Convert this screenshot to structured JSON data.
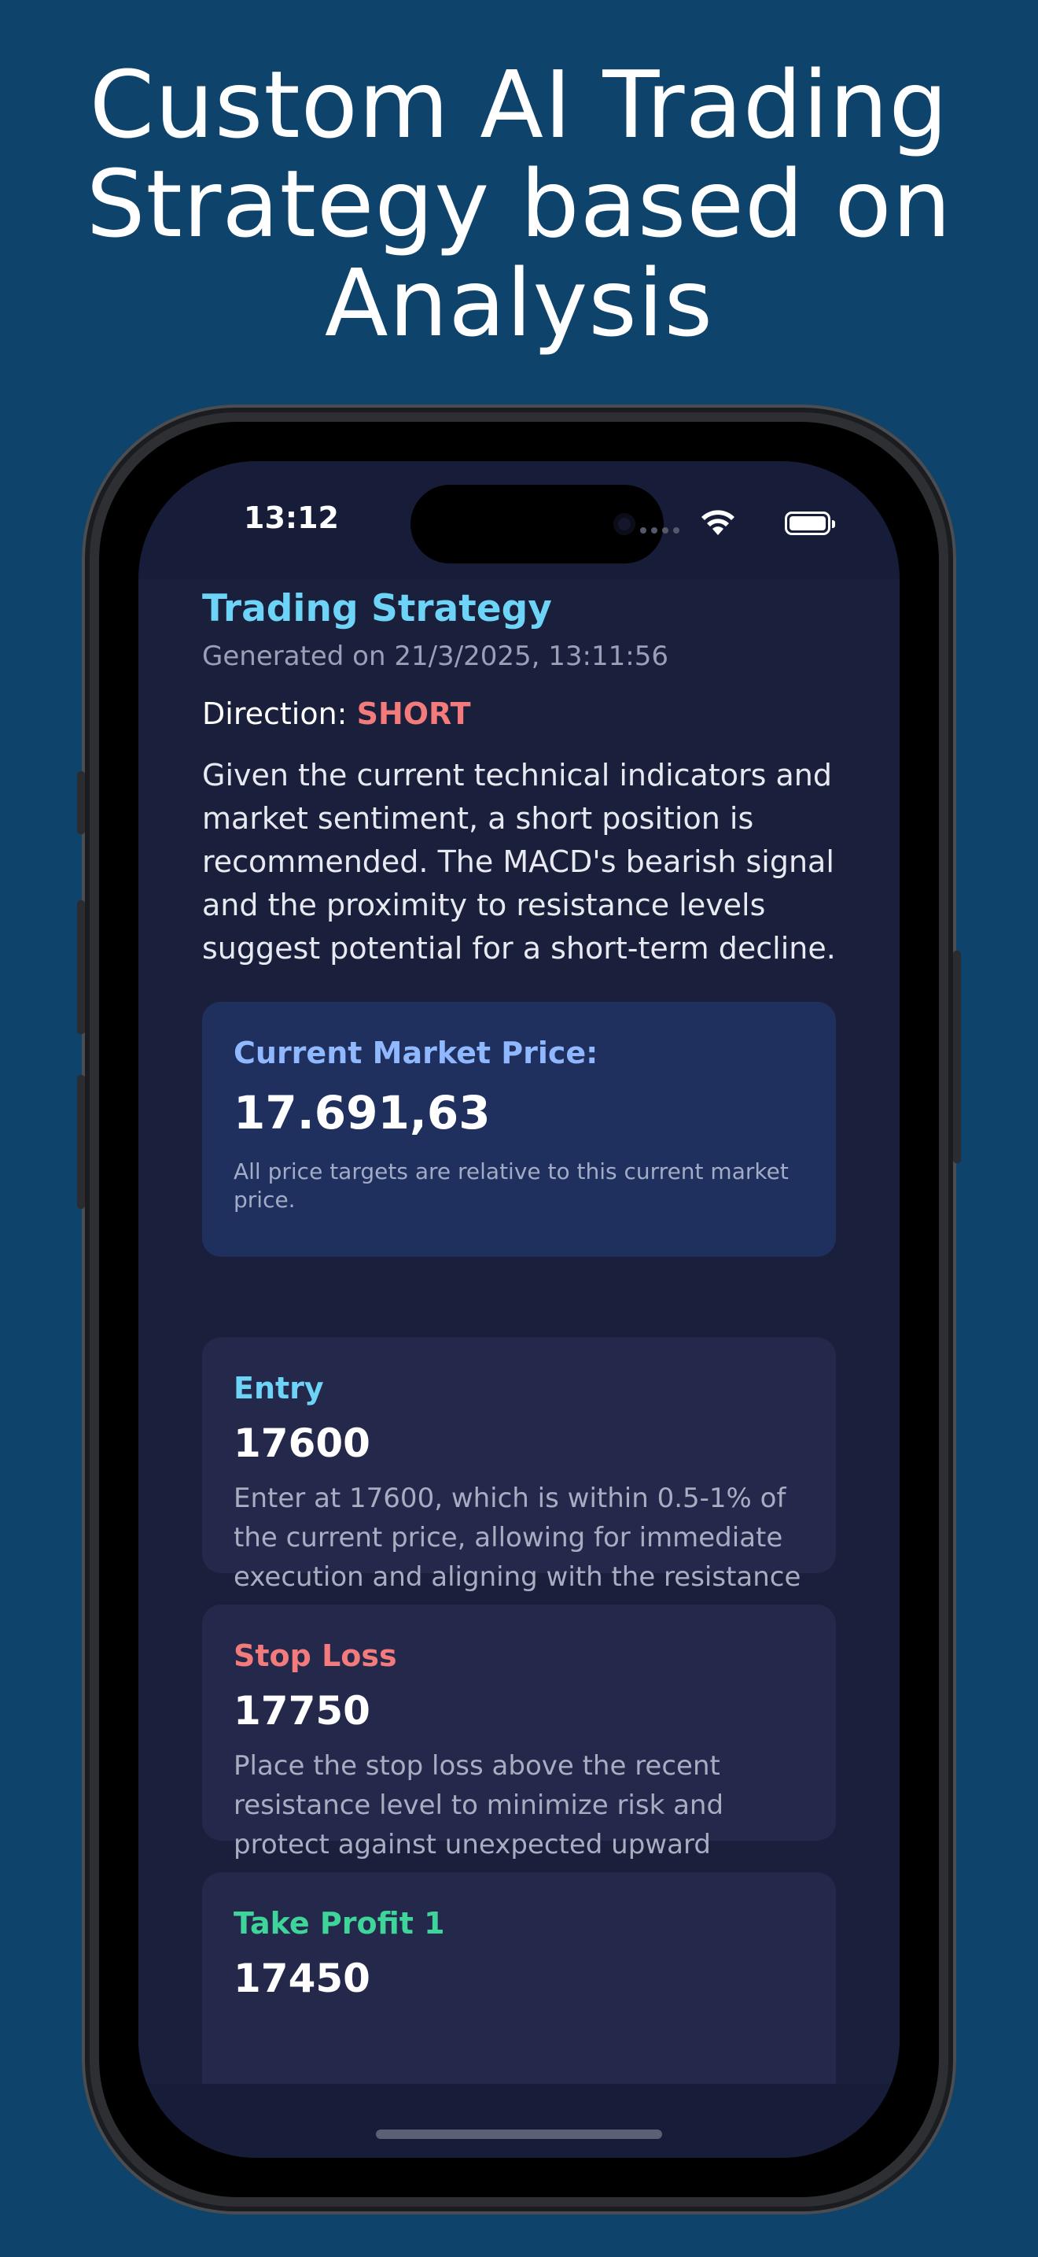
{
  "headline": {
    "line1": "Custom AI Trading",
    "line2": "Strategy based on",
    "line3": "Analysis"
  },
  "status_bar": {
    "time": "13:12",
    "icons": [
      "signal-icon",
      "wifi-icon",
      "battery-icon"
    ]
  },
  "strategy": {
    "title": "Trading Strategy",
    "generated": "Generated on 21/3/2025, 13:11:56",
    "direction_label": "Direction:",
    "direction_value": "SHORT",
    "summary": "Given the current technical indicators and market sentiment, a short position is recommended. The MACD's bearish signal and the proximity to resistance levels suggest potential for a short-term decline."
  },
  "market_price": {
    "label": "Current Market Price:",
    "value": "17.691,63",
    "note": "All price targets are relative to this current market price."
  },
  "levels": [
    {
      "label": "Entry",
      "value": "17600",
      "description": "Enter at 17600, which is within 0.5-1% of the current price, allowing for immediate execution and aligning with the resistance level.",
      "color": "#6dd3f7"
    },
    {
      "label": "Stop Loss",
      "value": "17750",
      "description": "Place the stop loss above the recent resistance level to minimize risk and protect against unexpected upward movements.",
      "color": "#f37b7b"
    },
    {
      "label": "Take Profit 1",
      "value": "17450",
      "description": "",
      "color": "#3fd49a"
    }
  ],
  "colors": {
    "background": "#0e436c",
    "screen": "#1a1f3b",
    "card": "#24284a",
    "price_card": "#20305e"
  }
}
